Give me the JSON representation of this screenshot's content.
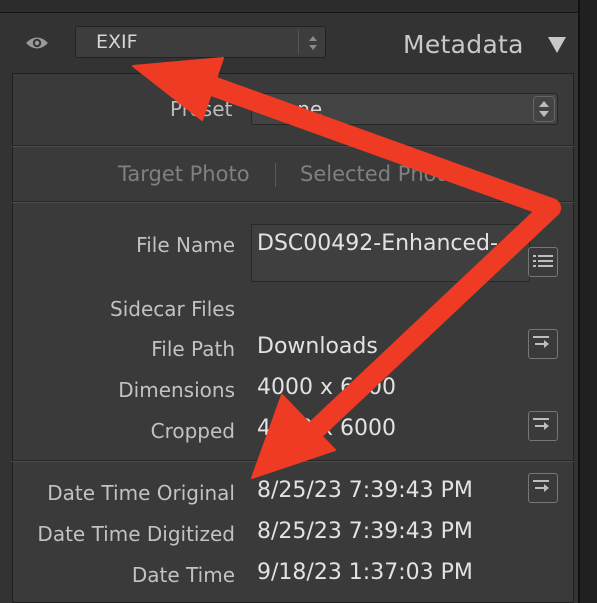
{
  "header": {
    "preset_value": "EXIF",
    "title": "Metadata"
  },
  "preset_row": {
    "label": "Preset",
    "value": "None"
  },
  "tabs": [
    {
      "label": "Target Photo"
    },
    {
      "label": "Selected Photos"
    }
  ],
  "fields": [
    {
      "label": "File Name",
      "value": "DSC00492-Enhanced-"
    },
    {
      "label": "Sidecar Files",
      "value": ""
    },
    {
      "label": "File Path",
      "value": "Downloads"
    },
    {
      "label": "Dimensions",
      "value": "4000 x 6000"
    },
    {
      "label": "Cropped",
      "value": "4000 x 6000"
    },
    {
      "label": "Date Time Original",
      "value": "8/25/23 7:39:43 PM"
    },
    {
      "label": "Date Time Digitized",
      "value": "8/25/23 7:39:43 PM"
    },
    {
      "label": "Date Time",
      "value": "9/18/23 1:37:03 PM"
    }
  ],
  "icons": {
    "visibility": "eye-icon",
    "stepper": "up-down-stepper-icon",
    "collapse": "triangle-down-icon",
    "list": "list-icon",
    "goto": "arrow-right-icon"
  },
  "colors": {
    "panel_bg": "#333333",
    "inner_bg": "#3a3a3a",
    "arrow_annotation": "#ef3b24"
  }
}
